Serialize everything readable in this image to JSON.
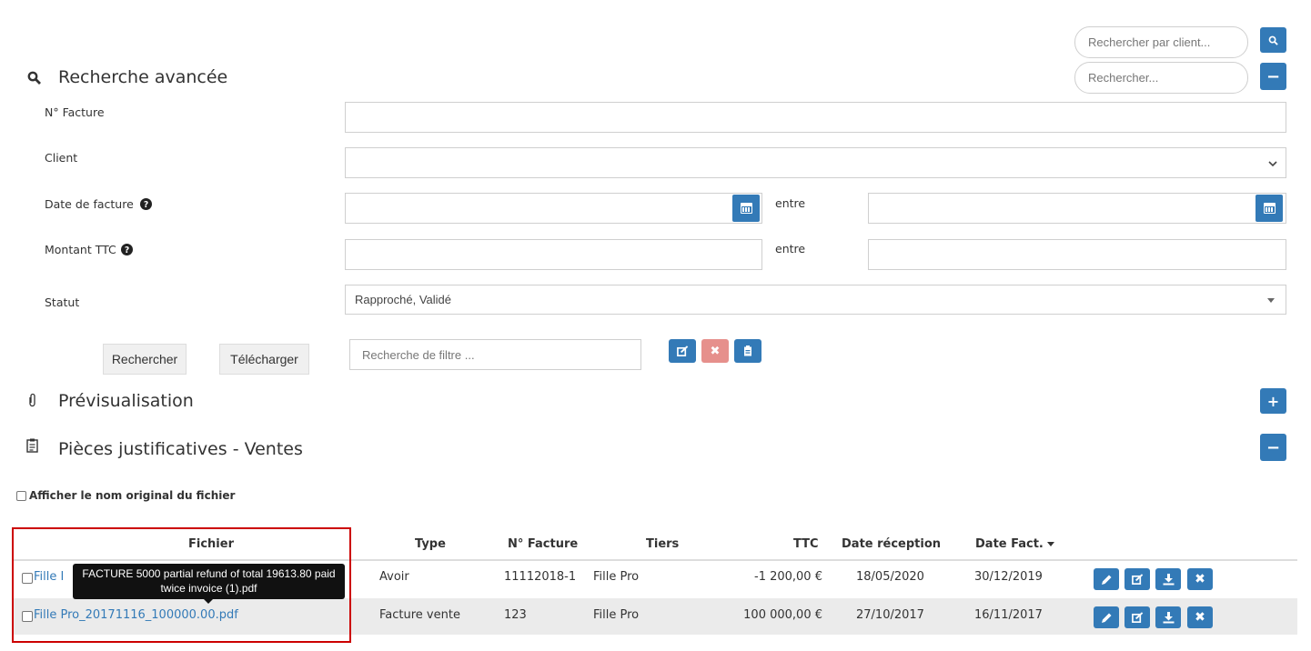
{
  "top_search": {
    "client_placeholder": "Rechercher par client...",
    "general_placeholder": "Rechercher...",
    "search_icon": "search-icon",
    "collapse_symbol": "−"
  },
  "advanced": {
    "title": "Recherche avancée",
    "icon": "search-icon",
    "labels": {
      "invoice_no": "N° Facture",
      "client": "Client",
      "invoice_date": "Date de facture",
      "amount": "Montant TTC",
      "status": "Statut"
    },
    "between": "entre",
    "status_value": "Rapproché, Validé",
    "search_button": "Rechercher",
    "download_button": "Télécharger",
    "filter_placeholder": "Recherche de filtre ..."
  },
  "preview": {
    "title": "Prévisualisation",
    "toggle_symbol": "+"
  },
  "documents": {
    "title": "Pièces justificatives - Ventes",
    "toggle_symbol": "−",
    "show_original_label": "Afficher le nom original du fichier"
  },
  "table": {
    "headers": {
      "file": "Fichier",
      "type": "Type",
      "invoice_no": "N° Facture",
      "third_party": "Tiers",
      "ttc": "TTC",
      "received": "Date réception",
      "invoice_date": "Date Fact."
    },
    "rows": [
      {
        "file_visible": "Fille I",
        "type": "Avoir",
        "invoice_no": "11112018-1",
        "third_party": "Fille Pro",
        "ttc": "-1 200,00 €",
        "received": "18/05/2020",
        "invoice_date": "30/12/2019"
      },
      {
        "file_visible": "Fille Pro_20171116_100000.00.pdf",
        "type": "Facture vente",
        "invoice_no": "123",
        "third_party": "Fille Pro",
        "ttc": "100 000,00 €",
        "received": "27/10/2017",
        "invoice_date": "16/11/2017"
      }
    ]
  },
  "tooltip": {
    "line1": "FACTURE 5000 partial refund of total 19613.80 paid",
    "line2": "twice invoice (1).pdf"
  },
  "colors": {
    "accent": "#337ab7",
    "danger_muted": "#e6908c",
    "highlight_box": "#cc0000"
  }
}
